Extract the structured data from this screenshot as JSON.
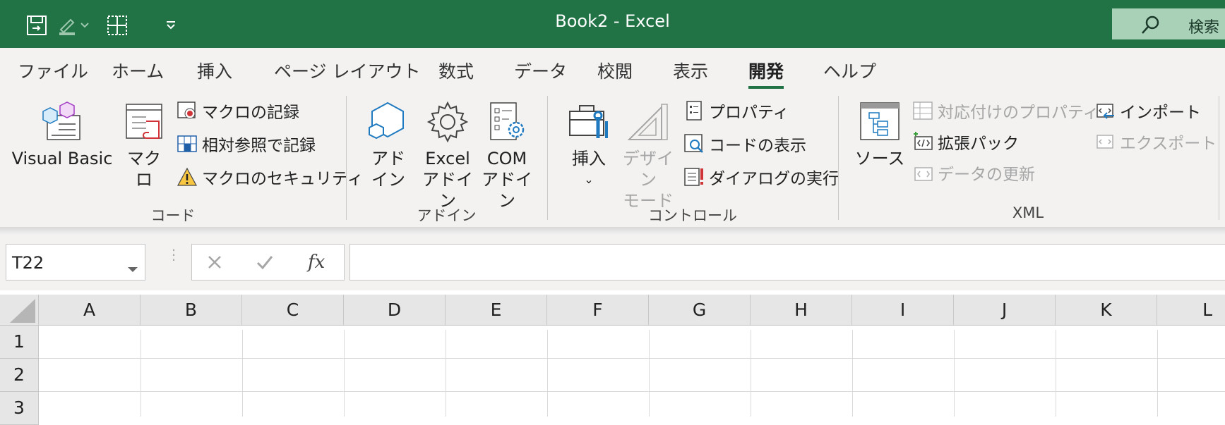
{
  "window": {
    "title": "Book2  -  Excel"
  },
  "search": {
    "label": "検索"
  },
  "tabs": [
    {
      "label": "ファイル"
    },
    {
      "label": "ホーム"
    },
    {
      "label": "挿入"
    },
    {
      "label": "ページ レイアウト"
    },
    {
      "label": "数式"
    },
    {
      "label": "データ"
    },
    {
      "label": "校閲"
    },
    {
      "label": "表示"
    },
    {
      "label": "開発",
      "active": true
    },
    {
      "label": "ヘルプ"
    }
  ],
  "ribbon": {
    "code": {
      "label": "コード",
      "visual_basic": "Visual Basic",
      "macro": "マクロ",
      "record_macro": "マクロの記録",
      "relative_ref": "相対参照で記録",
      "macro_security": "マクロのセキュリティ"
    },
    "addins": {
      "label": "アドイン",
      "addin_line1": "アド",
      "addin_line2": "イン",
      "excel_line1": "Excel",
      "excel_line2": "アドイン",
      "com_line1": "COM",
      "com_line2": "アドイン"
    },
    "controls": {
      "label": "コントロール",
      "insert": "挿入",
      "design_line1": "デザイン",
      "design_line2": "モード",
      "properties": "プロパティ",
      "view_code": "コードの表示",
      "run_dialog": "ダイアログの実行"
    },
    "xml": {
      "label": "XML",
      "source": "ソース",
      "map_properties": "対応付けのプロパティ",
      "expansion_packs": "拡張パック",
      "refresh_data": "データの更新",
      "import": "インポート",
      "export": "エクスポート"
    }
  },
  "formula_bar": {
    "name_box": "T22",
    "fx_label": "fx",
    "value": ""
  },
  "sheet": {
    "columns": [
      "A",
      "B",
      "C",
      "D",
      "E",
      "F",
      "G",
      "H",
      "I",
      "J",
      "K",
      "L"
    ],
    "rows": [
      "1",
      "2",
      "3"
    ]
  },
  "colors": {
    "title_green": "#217346",
    "ribbon_bg": "#f3f2f1",
    "header_gray": "#e6e6e6"
  }
}
